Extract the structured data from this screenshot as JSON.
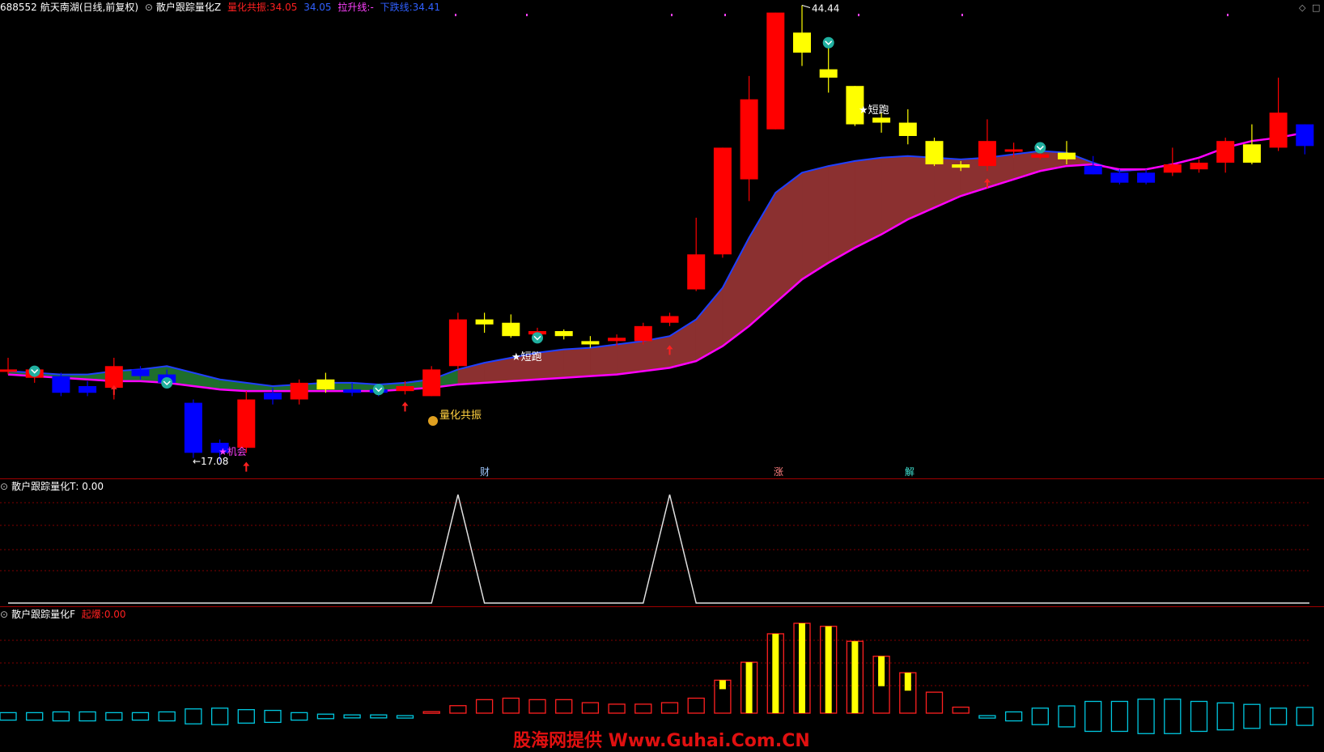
{
  "header": {
    "code": "688552",
    "stock_name": "航天南湖",
    "period": "(日线,前复权)",
    "indicator_name": "散户跟踪量化Z",
    "resonance_label": "量化共振:",
    "resonance_value": "34.05",
    "second_value": "34.05",
    "lift_label": "拉升线:",
    "lift_value": "-",
    "down_label": "下跌线:",
    "down_value": "34.41"
  },
  "panel_t": {
    "title": "散户跟踪量化T",
    "value": ": 0.00"
  },
  "panel_f": {
    "title": "散户跟踪量化F",
    "label": "起爆:",
    "value": "0.00"
  },
  "annotations": {
    "high": "44.44",
    "low": "17.08",
    "short_run": "★短跑",
    "opportunity": "★机会",
    "resonance_signal": "量化共振",
    "cai": "财",
    "zhang": "涨",
    "jie": "解"
  },
  "watermark": "股海网提供 Www.Guhai.Com.CN",
  "colors": {
    "up": "#ff0000",
    "down": "#0000ff",
    "neutral": "#ffff00",
    "band_fill": "#8b3030",
    "lower_line": "#ff00ff",
    "upper_line": "#2040ff",
    "green_fill": "#1e6e2c",
    "cyan": "#00c8e0",
    "grid": "#800000"
  },
  "chart_data": {
    "type": "candlestick",
    "high_marker": 44.44,
    "low_marker": 17.08,
    "candles": [
      {
        "o": 22.6,
        "c": 22.6,
        "h": 23.3,
        "l": 22.3,
        "col": "red"
      },
      {
        "o": 22.6,
        "c": 22.1,
        "h": 22.8,
        "l": 21.8,
        "col": "red"
      },
      {
        "o": 22.2,
        "c": 21.2,
        "h": 22.4,
        "l": 21.0,
        "col": "blue"
      },
      {
        "o": 21.6,
        "c": 21.2,
        "h": 21.9,
        "l": 21.0,
        "col": "blue"
      },
      {
        "o": 21.5,
        "c": 22.8,
        "h": 23.3,
        "l": 20.8,
        "col": "red"
      },
      {
        "o": 22.6,
        "c": 22.2,
        "h": 22.8,
        "l": 22.0,
        "col": "blue"
      },
      {
        "o": 22.3,
        "c": 21.8,
        "h": 22.6,
        "l": 21.5,
        "col": "blue"
      },
      {
        "o": 20.6,
        "c": 17.6,
        "h": 20.8,
        "l": 17.3,
        "col": "blue"
      },
      {
        "o": 18.2,
        "c": 17.6,
        "h": 18.4,
        "l": 17.08,
        "col": "blue"
      },
      {
        "o": 17.9,
        "c": 20.8,
        "h": 21.3,
        "l": 17.6,
        "col": "red"
      },
      {
        "o": 21.2,
        "c": 20.8,
        "h": 21.5,
        "l": 20.5,
        "col": "blue"
      },
      {
        "o": 20.8,
        "c": 21.8,
        "h": 22.0,
        "l": 20.5,
        "col": "red"
      },
      {
        "o": 21.4,
        "c": 22.0,
        "h": 22.4,
        "l": 21.2,
        "col": "yellow"
      },
      {
        "o": 21.4,
        "c": 21.2,
        "h": 21.8,
        "l": 21.0,
        "col": "blue"
      },
      {
        "o": 21.2,
        "c": 21.4,
        "h": 21.6,
        "l": 21.0,
        "col": "blue"
      },
      {
        "o": 21.3,
        "c": 21.6,
        "h": 21.9,
        "l": 21.1,
        "col": "red"
      },
      {
        "o": 21.0,
        "c": 22.6,
        "h": 22.8,
        "l": 21.0,
        "col": "red"
      },
      {
        "o": 22.8,
        "c": 25.6,
        "h": 26.0,
        "l": 22.6,
        "col": "red"
      },
      {
        "o": 25.6,
        "c": 25.3,
        "h": 26.0,
        "l": 24.8,
        "col": "yellow"
      },
      {
        "o": 25.4,
        "c": 24.6,
        "h": 25.9,
        "l": 24.5,
        "col": "yellow"
      },
      {
        "o": 24.9,
        "c": 24.7,
        "h": 25.1,
        "l": 24.5,
        "col": "red"
      },
      {
        "o": 24.9,
        "c": 24.6,
        "h": 25.0,
        "l": 24.4,
        "col": "yellow"
      },
      {
        "o": 24.3,
        "c": 24.1,
        "h": 24.6,
        "l": 23.9,
        "col": "yellow"
      },
      {
        "o": 24.3,
        "c": 24.5,
        "h": 24.7,
        "l": 24.0,
        "col": "red"
      },
      {
        "o": 24.3,
        "c": 25.2,
        "h": 25.4,
        "l": 24.1,
        "col": "red"
      },
      {
        "o": 25.4,
        "c": 25.8,
        "h": 26.0,
        "l": 25.2,
        "col": "red"
      },
      {
        "o": 27.4,
        "c": 29.5,
        "h": 31.7,
        "l": 27.3,
        "col": "red"
      },
      {
        "o": 29.5,
        "c": 35.9,
        "h": 35.9,
        "l": 29.3,
        "col": "red"
      },
      {
        "o": 34.0,
        "c": 38.8,
        "h": 40.2,
        "l": 32.7,
        "col": "red"
      },
      {
        "o": 37.0,
        "c": 44.0,
        "h": 44.0,
        "l": 37.0,
        "col": "red"
      },
      {
        "o": 42.8,
        "c": 41.6,
        "h": 44.44,
        "l": 40.8,
        "col": "yellow"
      },
      {
        "o": 40.6,
        "c": 40.1,
        "h": 41.9,
        "l": 39.2,
        "col": "yellow"
      },
      {
        "o": 39.6,
        "c": 37.3,
        "h": 39.6,
        "l": 37.2,
        "col": "yellow"
      },
      {
        "o": 37.7,
        "c": 37.4,
        "h": 38.0,
        "l": 36.8,
        "col": "yellow"
      },
      {
        "o": 37.4,
        "c": 36.6,
        "h": 38.2,
        "l": 36.1,
        "col": "yellow"
      },
      {
        "o": 36.3,
        "c": 34.9,
        "h": 36.5,
        "l": 34.8,
        "col": "yellow"
      },
      {
        "o": 34.9,
        "c": 34.7,
        "h": 35.1,
        "l": 34.5,
        "col": "yellow"
      },
      {
        "o": 34.8,
        "c": 36.3,
        "h": 37.6,
        "l": 34.5,
        "col": "red"
      },
      {
        "o": 35.7,
        "c": 35.8,
        "h": 36.2,
        "l": 35.3,
        "col": "red"
      },
      {
        "o": 35.3,
        "c": 35.5,
        "h": 35.7,
        "l": 35.2,
        "col": "red"
      },
      {
        "o": 35.6,
        "c": 35.2,
        "h": 36.3,
        "l": 34.9,
        "col": "yellow"
      },
      {
        "o": 34.8,
        "c": 34.3,
        "h": 35.4,
        "l": 34.3,
        "col": "blue"
      },
      {
        "o": 34.4,
        "c": 33.8,
        "h": 34.6,
        "l": 33.7,
        "col": "blue"
      },
      {
        "o": 34.4,
        "c": 33.8,
        "h": 34.6,
        "l": 33.7,
        "col": "blue"
      },
      {
        "o": 34.4,
        "c": 34.9,
        "h": 35.9,
        "l": 34.2,
        "col": "red"
      },
      {
        "o": 34.6,
        "c": 35.0,
        "h": 35.2,
        "l": 34.4,
        "col": "red"
      },
      {
        "o": 35.0,
        "c": 36.3,
        "h": 36.5,
        "l": 34.4,
        "col": "red"
      },
      {
        "o": 35.0,
        "c": 36.1,
        "h": 37.3,
        "l": 34.9,
        "col": "yellow"
      },
      {
        "o": 35.9,
        "c": 38.0,
        "h": 40.1,
        "l": 35.7,
        "col": "red"
      },
      {
        "o": 36.0,
        "c": 37.3,
        "h": 37.3,
        "l": 35.5,
        "col": "blue"
      }
    ],
    "t_series": [
      0,
      0,
      0,
      0,
      0,
      0,
      0,
      0,
      0,
      0,
      0,
      0,
      0,
      0,
      0,
      0,
      0,
      1,
      0,
      0,
      0,
      0,
      0,
      0,
      0,
      1,
      0,
      0,
      0,
      0,
      0,
      0,
      0,
      0,
      0,
      0,
      0,
      0,
      0,
      0,
      0,
      0,
      0,
      0,
      0,
      0,
      0,
      0,
      0,
      0
    ],
    "f_series": [
      {
        "v": 0.5,
        "t": "cyan",
        "y": 0
      },
      {
        "v": 0.5,
        "t": "cyan",
        "y": 0
      },
      {
        "v": 0.6,
        "t": "cyan",
        "y": 0
      },
      {
        "v": 0.6,
        "t": "cyan",
        "y": 0
      },
      {
        "v": 0.5,
        "t": "cyan",
        "y": 0
      },
      {
        "v": 0.5,
        "t": "cyan",
        "y": 0
      },
      {
        "v": 0.6,
        "t": "cyan",
        "y": 0
      },
      {
        "v": 1.0,
        "t": "cyan",
        "y": 0
      },
      {
        "v": 1.1,
        "t": "cyan",
        "y": 0
      },
      {
        "v": 0.9,
        "t": "cyan",
        "y": 0
      },
      {
        "v": 0.8,
        "t": "cyan",
        "y": 0
      },
      {
        "v": 0.5,
        "t": "cyan",
        "y": 0
      },
      {
        "v": 0.3,
        "t": "cyan",
        "y": 0
      },
      {
        "v": 0.2,
        "t": "cyan",
        "y": 0
      },
      {
        "v": 0.2,
        "t": "cyan",
        "y": 0
      },
      {
        "v": 0.1,
        "t": "cyan",
        "y": 0
      },
      {
        "v": 0.1,
        "t": "red",
        "y": 0
      },
      {
        "v": 0.5,
        "t": "red",
        "y": 0
      },
      {
        "v": 0.9,
        "t": "red",
        "y": 0
      },
      {
        "v": 1.0,
        "t": "red",
        "y": 0
      },
      {
        "v": 0.9,
        "t": "red",
        "y": 0
      },
      {
        "v": 0.9,
        "t": "red",
        "y": 0
      },
      {
        "v": 0.7,
        "t": "red",
        "y": 0
      },
      {
        "v": 0.6,
        "t": "red",
        "y": 0
      },
      {
        "v": 0.6,
        "t": "red",
        "y": 0
      },
      {
        "v": 0.7,
        "t": "red",
        "y": 0
      },
      {
        "v": 1.0,
        "t": "red",
        "y": 0
      },
      {
        "v": 2.2,
        "t": "red",
        "y": 0.6
      },
      {
        "v": 3.4,
        "t": "red",
        "y": 3.4
      },
      {
        "v": 5.3,
        "t": "red",
        "y": 5.3
      },
      {
        "v": 6.0,
        "t": "red",
        "y": 6.0
      },
      {
        "v": 5.8,
        "t": "red",
        "y": 5.8
      },
      {
        "v": 4.8,
        "t": "red",
        "y": 4.8
      },
      {
        "v": 3.8,
        "t": "red",
        "y": 2.0
      },
      {
        "v": 2.7,
        "t": "red",
        "y": 1.2
      },
      {
        "v": 1.4,
        "t": "red",
        "y": 0
      },
      {
        "v": 0.4,
        "t": "red",
        "y": 0
      },
      {
        "v": 0.1,
        "t": "cyan",
        "y": 0
      },
      {
        "v": 0.6,
        "t": "cyan",
        "y": 0
      },
      {
        "v": 1.1,
        "t": "cyan",
        "y": 0
      },
      {
        "v": 1.4,
        "t": "cyan",
        "y": 0
      },
      {
        "v": 2.0,
        "t": "cyan",
        "y": 0
      },
      {
        "v": 2.0,
        "t": "cyan",
        "y": 0
      },
      {
        "v": 2.3,
        "t": "cyan",
        "y": 0
      },
      {
        "v": 2.3,
        "t": "cyan",
        "y": 0
      },
      {
        "v": 2.0,
        "t": "cyan",
        "y": 0
      },
      {
        "v": 1.8,
        "t": "cyan",
        "y": 0
      },
      {
        "v": 1.6,
        "t": "cyan",
        "y": 0
      },
      {
        "v": 1.1,
        "t": "cyan",
        "y": 0
      },
      {
        "v": 1.2,
        "t": "cyan",
        "y": 0
      }
    ],
    "upper_line": [
      22.5,
      22.4,
      22.3,
      22.3,
      22.5,
      22.6,
      22.8,
      22.4,
      22.0,
      21.8,
      21.6,
      21.7,
      21.8,
      21.8,
      21.7,
      21.8,
      22.0,
      22.6,
      23.0,
      23.3,
      23.6,
      23.8,
      23.9,
      24.1,
      24.3,
      24.6,
      25.6,
      27.5,
      30.5,
      33.2,
      34.4,
      34.8,
      35.1,
      35.3,
      35.4,
      35.3,
      35.2,
      35.3,
      35.5,
      35.7,
      35.6,
      35.0,
      34.5,
      34.6,
      34.9,
      35.3,
      35.9,
      36.3,
      36.5,
      36.8
    ],
    "lower_line": [
      22.3,
      22.2,
      22.1,
      22.0,
      21.9,
      21.9,
      21.8,
      21.6,
      21.4,
      21.3,
      21.3,
      21.3,
      21.3,
      21.3,
      21.3,
      21.4,
      21.5,
      21.7,
      21.8,
      21.9,
      22.0,
      22.1,
      22.2,
      22.3,
      22.5,
      22.7,
      23.1,
      24.0,
      25.2,
      26.6,
      28.0,
      29.0,
      29.9,
      30.7,
      31.6,
      32.3,
      33.0,
      33.5,
      34.0,
      34.5,
      34.8,
      34.9,
      34.6,
      34.6,
      34.9,
      35.3,
      35.9,
      36.3,
      36.5,
      36.8
    ]
  }
}
